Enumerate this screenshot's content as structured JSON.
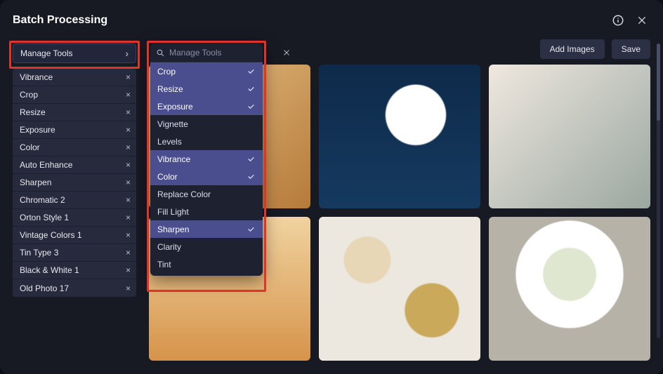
{
  "title": "Batch Processing",
  "actions": {
    "add": "Add Images",
    "save": "Save"
  },
  "manage_label": "Manage Tools",
  "search_placeholder": "Manage Tools",
  "sidebar_tools": [
    "Vibrance",
    "Crop",
    "Resize",
    "Exposure",
    "Color",
    "Auto Enhance",
    "Sharpen",
    "Chromatic 2",
    "Orton Style 1",
    "Vintage Colors 1",
    "Tin Type 3",
    "Black & White 1",
    "Old Photo 17"
  ],
  "popup_options": [
    {
      "label": "Crop",
      "selected": true
    },
    {
      "label": "Resize",
      "selected": true
    },
    {
      "label": "Exposure",
      "selected": true
    },
    {
      "label": "Vignette",
      "selected": false
    },
    {
      "label": "Levels",
      "selected": false
    },
    {
      "label": "Vibrance",
      "selected": true
    },
    {
      "label": "Color",
      "selected": true
    },
    {
      "label": "Replace Color",
      "selected": false
    },
    {
      "label": "Fill Light",
      "selected": false
    },
    {
      "label": "Sharpen",
      "selected": true
    },
    {
      "label": "Clarity",
      "selected": false
    },
    {
      "label": "Tint",
      "selected": false
    }
  ]
}
